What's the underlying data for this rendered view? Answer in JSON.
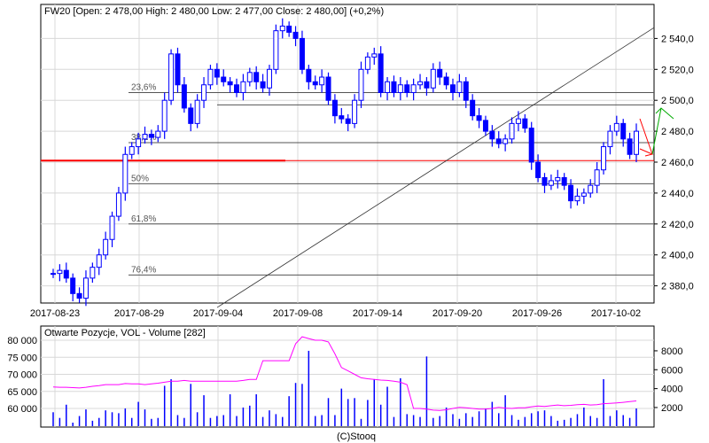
{
  "header": "FW20 [Open: 2 478,00  High: 2 480,00  Low: 2 477,00  Close: 2 480,00] (+0,2%)",
  "volume_title": "Otwarte Pozycje, VOL - Volume [282]",
  "footer": "(C)Stooq",
  "colors": {
    "price": "#0000ff",
    "oi": "#ff00ff",
    "support": "#ff0000",
    "fib": "#555555",
    "grid": "#d8d8d8"
  },
  "chart_data": [
    {
      "type": "line",
      "title": "FW20",
      "x_tick_labels": [
        "2017-08-23",
        "2017-08-29",
        "2017-09-04",
        "2017-09-08",
        "2017-09-14",
        "2017-09-20",
        "2017-09-26",
        "2017-10-02"
      ],
      "y_tick_labels": [
        "2 380,0",
        "2 400,0",
        "2 420,0",
        "2 440,0",
        "2 460,0",
        "2 480,0",
        "2 500,0",
        "2 520,0",
        "2 540,0"
      ],
      "y_ticks": [
        2380,
        2400,
        2420,
        2440,
        2460,
        2480,
        2500,
        2520,
        2540
      ],
      "ylim": [
        2366,
        2553
      ],
      "closes": [
        2388,
        2390,
        2385,
        2375,
        2372,
        2385,
        2392,
        2400,
        2410,
        2425,
        2440,
        2465,
        2470,
        2475,
        2478,
        2476,
        2480,
        2500,
        2530,
        2510,
        2495,
        2485,
        2500,
        2510,
        2520,
        2515,
        2512,
        2510,
        2505,
        2512,
        2518,
        2512,
        2508,
        2520,
        2545,
        2548,
        2544,
        2540,
        2520,
        2512,
        2510,
        2515,
        2500,
        2490,
        2488,
        2485,
        2500,
        2520,
        2528,
        2530,
        2505,
        2512,
        2505,
        2510,
        2505,
        2510,
        2512,
        2508,
        2520,
        2515,
        2510,
        2505,
        2512,
        2500,
        2490,
        2487,
        2480,
        2475,
        2472,
        2475,
        2485,
        2488,
        2482,
        2460,
        2450,
        2445,
        2448,
        2450,
        2445,
        2435,
        2438,
        2440,
        2445,
        2455,
        2470,
        2480,
        2485,
        2475,
        2465,
        2480
      ],
      "fib_levels": [
        {
          "label": "23,6%",
          "value": 2505
        },
        {
          "label": "38,2%",
          "value": 2472.6
        },
        {
          "label": "50%",
          "value": 2446
        },
        {
          "label": "61,8%",
          "value": 2420
        },
        {
          "label": "76,4%",
          "value": 2387
        }
      ],
      "extra_level": 2497,
      "support_level": 2461,
      "trendline": {
        "from": 2366,
        "to": 2547
      }
    },
    {
      "type": "bar",
      "title": "Otwarte Pozycje, VOL - Volume [282]",
      "left_axis_labels": [
        "60 000",
        "65 000",
        "70 000",
        "75 000",
        "80 000"
      ],
      "left_axis_values": [
        60000,
        65000,
        70000,
        75000,
        80000
      ],
      "right_axis_labels": [
        "2000",
        "4000",
        "6000",
        "8000"
      ],
      "right_axis_values": [
        2000,
        4000,
        6000,
        8000
      ],
      "volume": [
        1500,
        900,
        2300,
        400,
        1100,
        1800,
        600,
        900,
        1700,
        1500,
        1400,
        1900,
        900,
        2600,
        1800,
        800,
        900,
        4300,
        5000,
        1200,
        900,
        4500,
        1500,
        3300,
        900,
        1100,
        1200,
        3400,
        1100,
        2000,
        2200,
        3400,
        1000,
        1700,
        1300,
        1000,
        3200,
        4600,
        4500,
        8000,
        1100,
        1200,
        3000,
        1200,
        4000,
        2900,
        3000,
        800,
        2800,
        5000,
        2300,
        4200,
        1000,
        5100,
        1300,
        1200,
        1000,
        7400,
        900,
        1100,
        2000,
        1300,
        800,
        1400,
        1000,
        1600,
        1900,
        2600,
        1400,
        3300,
        1200,
        700,
        1000,
        1400,
        1600,
        1700,
        1100,
        600,
        700,
        900,
        1300,
        2000,
        1100,
        900,
        5000,
        1100,
        1700,
        1200,
        900,
        1900
      ],
      "open_interest": [
        66300,
        66200,
        66200,
        66100,
        66000,
        66200,
        66500,
        66700,
        67000,
        67000,
        67000,
        67300,
        67200,
        67200,
        67000,
        67200,
        67400,
        67700,
        68000,
        68000,
        68200,
        68000,
        68000,
        68000,
        68000,
        68000,
        68000,
        68000,
        68000,
        68200,
        68500,
        68500,
        74000,
        74000,
        74000,
        74000,
        74000,
        79000,
        81000,
        80500,
        80000,
        80000,
        79500,
        76000,
        72000,
        71000,
        70000,
        69000,
        68700,
        68500,
        68300,
        68200,
        68000,
        67700,
        67000,
        60000,
        60000,
        59800,
        59500,
        59400,
        59600,
        60000,
        60300,
        60200,
        60000,
        59800,
        59800,
        60000,
        60300,
        60100,
        60000,
        60200,
        60200,
        60500,
        60700,
        60600,
        60800,
        61000,
        60800,
        60900,
        61100,
        61200,
        61000,
        61100,
        61400,
        61500,
        61600,
        61800,
        62000,
        62200
      ]
    }
  ]
}
